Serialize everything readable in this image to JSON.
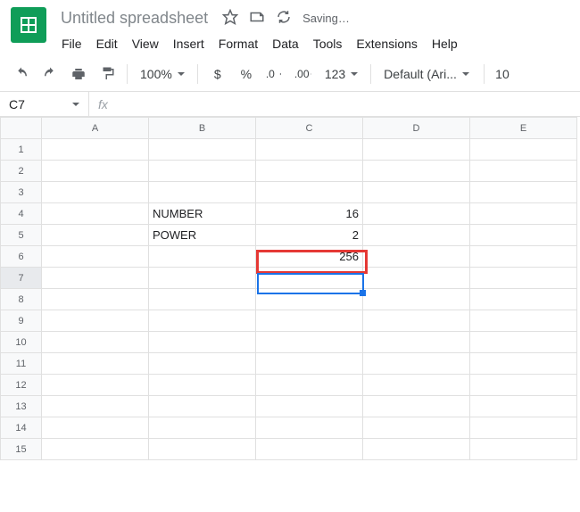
{
  "doc": {
    "title": "Untitled spreadsheet",
    "status": "Saving…"
  },
  "menu": {
    "file": "File",
    "edit": "Edit",
    "view": "View",
    "insert": "Insert",
    "format": "Format",
    "data": "Data",
    "tools": "Tools",
    "extensions": "Extensions",
    "help": "Help"
  },
  "toolbar": {
    "zoom": "100%",
    "currency": "$",
    "percent": "%",
    "dec_minus": ".0",
    "dec_plus": ".00",
    "more_formats": "123",
    "font": "Default (Ari...",
    "font_size": "10"
  },
  "nameBox": "C7",
  "cols": [
    "A",
    "B",
    "C",
    "D",
    "E"
  ],
  "rows": [
    "1",
    "2",
    "3",
    "4",
    "5",
    "6",
    "7",
    "8",
    "9",
    "10",
    "11",
    "12",
    "13",
    "14",
    "15"
  ],
  "cells": {
    "b4": "NUMBER",
    "c4": "16",
    "b5": "POWER",
    "c5": "2",
    "c6": "256"
  }
}
